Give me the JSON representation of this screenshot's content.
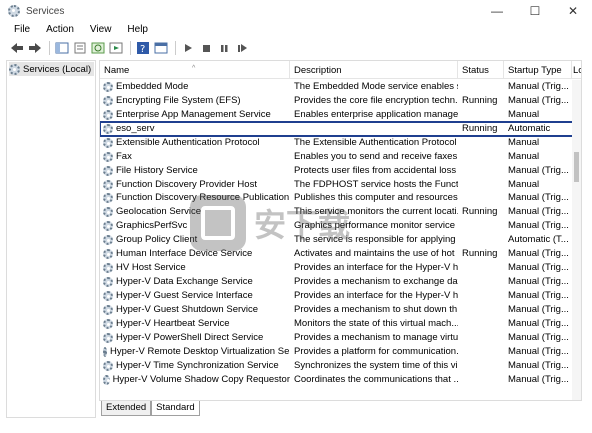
{
  "window": {
    "title": "Services",
    "controls": [
      "—",
      "☐",
      "✕"
    ]
  },
  "menu": [
    "File",
    "Action",
    "View",
    "Help"
  ],
  "toolbar": [
    "back-icon",
    "forward-icon",
    "show-tree-icon",
    "properties-icon",
    "refresh-icon",
    "export-icon",
    "help-icon",
    "console-icon",
    "start-icon",
    "stop-icon",
    "pause-icon",
    "restart-icon"
  ],
  "tree": {
    "root_label": "Services (Local)"
  },
  "columns": {
    "name": "Name",
    "description": "Description",
    "status": "Status",
    "startup": "Startup Type",
    "log": "Lo"
  },
  "services": [
    {
      "name": "Embedded Mode",
      "description": "The Embedded Mode service enables sc...",
      "status": "",
      "startup": "Manual (Trig...",
      "log": "Lo"
    },
    {
      "name": "Encrypting File System (EFS)",
      "description": "Provides the core file encryption techn...",
      "status": "Running",
      "startup": "Manual (Trig...",
      "log": "Lo"
    },
    {
      "name": "Enterprise App Management Service",
      "description": "Enables enterprise application manage...",
      "status": "",
      "startup": "Manual",
      "log": "Lo"
    },
    {
      "name": "eso_serv",
      "description": "",
      "status": "Running",
      "startup": "Automatic",
      "log": "Lo"
    },
    {
      "name": "Extensible Authentication Protocol",
      "description": "The Extensible Authentication Protocol ...",
      "status": "",
      "startup": "Manual",
      "log": "Lo"
    },
    {
      "name": "Fax",
      "description": "Enables you to send and receive faxes, ...",
      "status": "",
      "startup": "Manual",
      "log": "Lo"
    },
    {
      "name": "File History Service",
      "description": "Protects user files from accidental loss ...",
      "status": "",
      "startup": "Manual (Trig...",
      "log": "Lo"
    },
    {
      "name": "Function Discovery Provider Host",
      "description": "The FDPHOST service hosts the Functio...",
      "status": "",
      "startup": "Manual",
      "log": "Lo"
    },
    {
      "name": "Function Discovery Resource Publication",
      "description": "Publishes this computer and resources ...",
      "status": "",
      "startup": "Manual (Trig...",
      "log": "Lo"
    },
    {
      "name": "Geolocation Service",
      "description": "This service monitors the current locati...",
      "status": "Running",
      "startup": "Manual (Trig...",
      "log": "Lo"
    },
    {
      "name": "GraphicsPerfSvc",
      "description": "Graphics performance monitor service",
      "status": "",
      "startup": "Manual (Trig...",
      "log": "Lo"
    },
    {
      "name": "Group Policy Client",
      "description": "The service is responsible for applying s...",
      "status": "",
      "startup": "Automatic (T...",
      "log": "Lo"
    },
    {
      "name": "Human Interface Device Service",
      "description": "Activates and maintains the use of hot ...",
      "status": "Running",
      "startup": "Manual (Trig...",
      "log": "Lo"
    },
    {
      "name": "HV Host Service",
      "description": "Provides an interface for the Hyper-V h...",
      "status": "",
      "startup": "Manual (Trig...",
      "log": "Lo"
    },
    {
      "name": "Hyper-V Data Exchange Service",
      "description": "Provides a mechanism to exchange dat...",
      "status": "",
      "startup": "Manual (Trig...",
      "log": "Lo"
    },
    {
      "name": "Hyper-V Guest Service Interface",
      "description": "Provides an interface for the Hyper-V h...",
      "status": "",
      "startup": "Manual (Trig...",
      "log": "Lo"
    },
    {
      "name": "Hyper-V Guest Shutdown Service",
      "description": "Provides a mechanism to shut down th...",
      "status": "",
      "startup": "Manual (Trig...",
      "log": "Lo"
    },
    {
      "name": "Hyper-V Heartbeat Service",
      "description": "Monitors the state of this virtual mach...",
      "status": "",
      "startup": "Manual (Trig...",
      "log": "Lo"
    },
    {
      "name": "Hyper-V PowerShell Direct Service",
      "description": "Provides a mechanism to manage virtu...",
      "status": "",
      "startup": "Manual (Trig...",
      "log": "Lo"
    },
    {
      "name": "Hyper-V Remote Desktop Virtualization Ser...",
      "description": "Provides a platform for communication...",
      "status": "",
      "startup": "Manual (Trig...",
      "log": "Lo"
    },
    {
      "name": "Hyper-V Time Synchronization Service",
      "description": "Synchronizes the system time of this vi...",
      "status": "",
      "startup": "Manual (Trig...",
      "log": "Lo"
    },
    {
      "name": "Hyper-V Volume Shadow Copy Requestor",
      "description": "Coordinates the communications that ...",
      "status": "",
      "startup": "Manual (Trig...",
      "log": "Lo"
    }
  ],
  "highlight_color": "#1f3f8f",
  "tabs": [
    "Extended",
    "Standard"
  ],
  "watermark": "安下载"
}
